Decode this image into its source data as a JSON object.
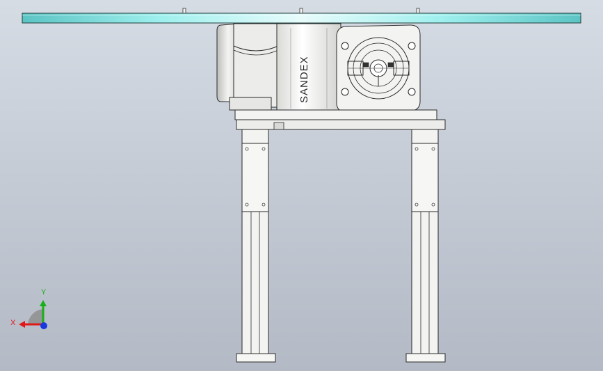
{
  "model": {
    "brand_marking": "SANDEX"
  },
  "triad": {
    "x_label": "X",
    "y_label": "Y",
    "x_color": "#e01818",
    "y_color": "#18b018",
    "z_color": "#1838e0"
  },
  "colors": {
    "background_top": "#d6dce4",
    "background_bottom": "#b3bac5",
    "plate_fill": "#7fe0e0",
    "part_fill": "#f2f2f0",
    "edge_color": "#2a2a2a"
  }
}
